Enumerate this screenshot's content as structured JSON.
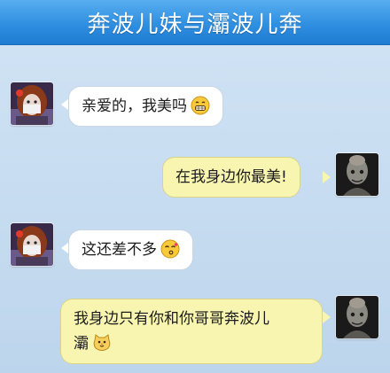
{
  "header": {
    "title": "奔波儿妹与灞波儿奔"
  },
  "messages": [
    {
      "side": "left",
      "sender": "girl",
      "text": "亲爱的，我美吗",
      "emoji": "grin-emoji"
    },
    {
      "side": "right",
      "sender": "man",
      "text": "在我身边你最美!"
    },
    {
      "side": "left",
      "sender": "girl",
      "text": "这还差不多",
      "emoji": "kiss-emoji"
    },
    {
      "side": "right",
      "sender": "man",
      "line1": "我身边只有你和你哥哥奔波儿",
      "line2": "灞",
      "emoji": "cat-emoji"
    }
  ],
  "colors": {
    "title_bar": "#2f8fe0",
    "chat_background": "#bfd7ee",
    "left_bubble": "#ffffff",
    "right_bubble": "#f7f5b0"
  }
}
